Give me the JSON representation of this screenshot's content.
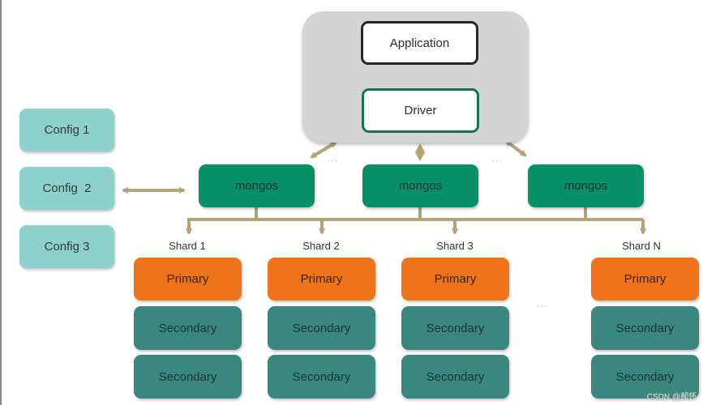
{
  "client": {
    "application_label": "Application",
    "driver_label": "Driver"
  },
  "config_servers": [
    {
      "label": "Config 1"
    },
    {
      "label": "Config  2"
    },
    {
      "label": "Config 3"
    }
  ],
  "routers": [
    {
      "label": "mongos"
    },
    {
      "label": "mongos"
    },
    {
      "label": "mongos"
    }
  ],
  "shards": [
    {
      "name": "Shard 1",
      "primary": "Primary",
      "secondaries": [
        "Secondary",
        "Secondary"
      ]
    },
    {
      "name": "Shard 2",
      "primary": "Primary",
      "secondaries": [
        "Secondary",
        "Secondary"
      ]
    },
    {
      "name": "Shard 3",
      "primary": "Primary",
      "secondaries": [
        "Secondary",
        "Secondary"
      ]
    },
    {
      "name": "Shard N",
      "primary": "Primary",
      "secondaries": [
        "Secondary",
        "Secondary"
      ]
    }
  ],
  "ellipsis": "···",
  "watermark": "CSDN @郝怀",
  "colors": {
    "connector": "#b3a27a",
    "config": "#8ed0cb",
    "mongos": "#089066",
    "primary": "#ef7419",
    "secondary": "#3a877f",
    "client_container": "#d4d4d4",
    "driver_border": "#18714f"
  }
}
